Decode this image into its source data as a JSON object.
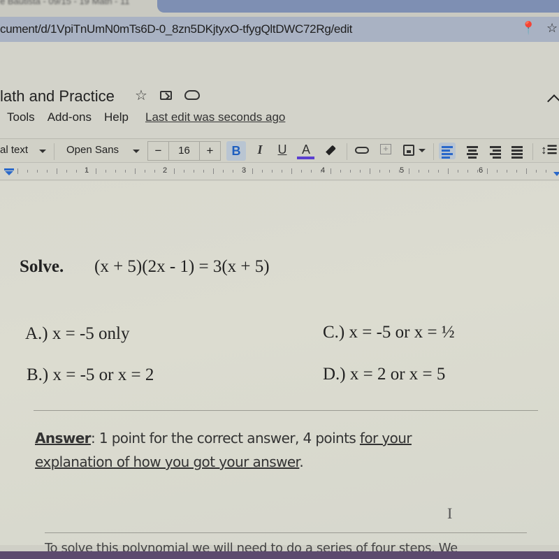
{
  "browser": {
    "tab_inactive_text": "e Bautista - 09/15 - 19 Math - 11",
    "url": "cument/d/1VpiTnUmN0mTs6D-0_8zn5DKjtyxO-tfygQltDWC72Rg/edit",
    "icons": [
      "location-pin-icon",
      "bookmark-star-icon"
    ]
  },
  "doc": {
    "title": "lath and Practice",
    "title_icons": [
      "star-icon",
      "move-to-folder-icon",
      "cloud-status-icon"
    ],
    "menu": [
      "Tools",
      "Add-ons",
      "Help"
    ],
    "last_edit": "Last edit was seconds ago"
  },
  "toolbar": {
    "style": "al text",
    "font": "Open Sans",
    "font_size": "16",
    "decrease": "−",
    "increase": "+",
    "bold": "B",
    "italic": "I",
    "underline": "U",
    "text_color": "A",
    "text_color_value": "#5a3fd0",
    "line_spacing": "↕☰",
    "active_alignment": "left"
  },
  "ruler": {
    "numbers": [
      "1",
      "2",
      "3",
      "4",
      "5",
      "6"
    ]
  },
  "content": {
    "solve_label": "Solve.",
    "equation": "(x + 5)(2x - 1) = 3(x + 5)",
    "choices": {
      "a": "A.)  x = -5 only",
      "b": "B.)  x = -5  or  x = 2",
      "c": "C.)  x = -5  or  x = ½",
      "d": "D.)  x = 2  or  x = 5"
    },
    "answer_label": "Answer",
    "answer_text_1": ": 1 point for the correct answer, 4 points ",
    "answer_text_underlined_1": "for your",
    "answer_text_underlined_2": "explanation of how you got your answer",
    "answer_text_end": ".",
    "cursor": "I",
    "solution_text": "To solve this polynomial we will need to do a series of four steps. We"
  }
}
